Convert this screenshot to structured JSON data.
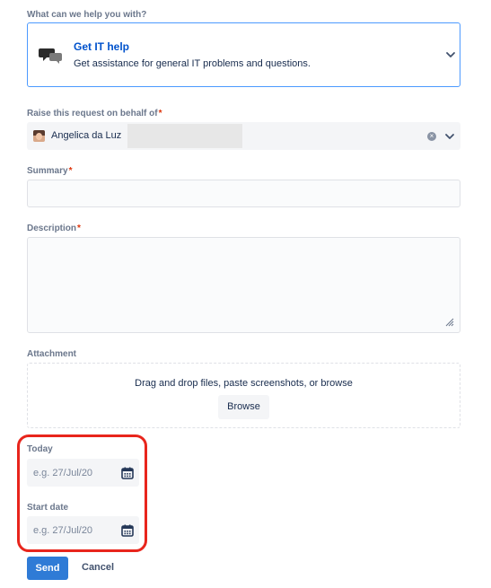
{
  "request_type": {
    "question": "What can we help you with?",
    "title": "Get IT help",
    "description": "Get assistance for general IT problems and questions.",
    "icon": "chat-bubbles-icon"
  },
  "behalf": {
    "label": "Raise this request on behalf of",
    "required_mark": "*",
    "name": "Angelica da Luz"
  },
  "summary": {
    "label": "Summary",
    "required_mark": "*",
    "value": ""
  },
  "description": {
    "label": "Description",
    "required_mark": "*",
    "value": ""
  },
  "attachment": {
    "label": "Attachment",
    "dropzone_text": "Drag and drop files, paste screenshots, or browse",
    "browse_label": "Browse"
  },
  "today": {
    "label": "Today",
    "placeholder": "e.g. 27/Jul/20"
  },
  "start_date": {
    "label": "Start date",
    "placeholder": "e.g. 27/Jul/20"
  },
  "actions": {
    "send_label": "Send",
    "cancel_label": "Cancel"
  },
  "colors": {
    "primary": "#2f7bd6",
    "link": "#0052cc",
    "required": "#de350b",
    "highlight": "#e8251c",
    "focus_border": "#4c9aff"
  }
}
